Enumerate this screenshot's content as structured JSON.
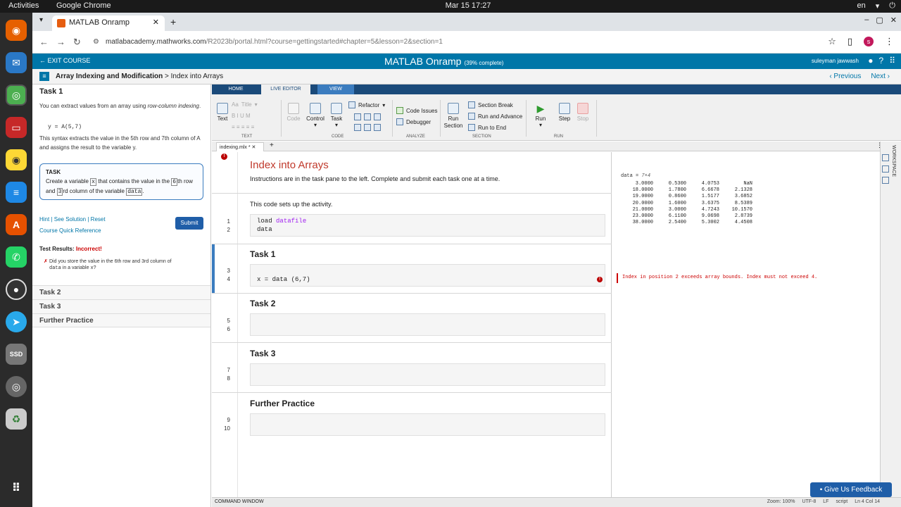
{
  "desktop": {
    "activities": "Activities",
    "app_name": "Google Chrome",
    "clock": "Mar 15  17:27",
    "lang": "en"
  },
  "browser": {
    "tab_title": "MATLAB Onramp",
    "url_host": "matlabacademy.mathworks.com",
    "url_path": "/R2023b/portal.html?course=gettingstarted#chapter=5&lesson=2&section=1",
    "profile_initial": "s"
  },
  "header": {
    "exit": "EXIT COURSE",
    "title": "MATLAB Onramp",
    "progress": "(39% complete)",
    "user": "suleyman jawwash"
  },
  "lessonbar": {
    "lesson": "Array Indexing and Modification",
    "section": "Index into Arrays",
    "previous": "Previous",
    "next": "Next"
  },
  "taskpane": {
    "task1_heading": "Task 1",
    "intro_a": "You can extract values from an array using",
    "intro_em": "row-column indexing",
    "intro_b": ".",
    "code_example": "y = A(5,7)",
    "explain": "This syntax extracts the value in the 5th row and 7th column of A and assigns the result to the variable y.",
    "task_caption": "TASK",
    "task_a": "Create a variable",
    "task_var": "x",
    "task_b": "that contains the value in the",
    "task_row": "6",
    "task_c": "th row and",
    "task_col": "3",
    "task_d": "rd column of the variable",
    "task_data": "data",
    "task_e": ".",
    "hint": "Hint",
    "solution": "See Solution",
    "reset": "Reset",
    "reference": "Course Quick Reference",
    "submit": "Submit",
    "results_label": "Test Results:",
    "results_value": "Incorrect!",
    "result_msg_a": "Did you store the value in the 6th row and 3rd column of",
    "result_msg_b": "data",
    "result_msg_c": "in a variable",
    "result_msg_d": "x",
    "result_msg_e": "?",
    "task2": "Task 2",
    "task3": "Task 3",
    "further": "Further Practice"
  },
  "toolstrip": {
    "tabs": [
      "HOME",
      "LIVE EDITOR",
      "VIEW"
    ],
    "text": "Text",
    "title": "Title",
    "code": "Code",
    "control": "Control",
    "task": "Task",
    "refactor": "Refactor",
    "code_issues": "Code Issues",
    "debugger": "Debugger",
    "run_section": "Run Section",
    "section_break": "Section Break",
    "run_advance": "Run and Advance",
    "run_to_end": "Run to End",
    "run": "Run",
    "step": "Step",
    "stop": "Stop",
    "groups": [
      "TEXT",
      "CODE",
      "ANALYZE",
      "SECTION",
      "RUN"
    ]
  },
  "editor": {
    "tab_name": "indexing.mlx *",
    "title": "Index into Arrays",
    "instructions": "Instructions are in the task pane to the left. Complete and submit each task one at a time.",
    "setup_text": "This code sets up the activity.",
    "code1_kw": "load",
    "code1_arg": "datafile",
    "code2": "data",
    "task1": "Task 1",
    "task1_code": "x = data (6,7)",
    "task2": "Task 2",
    "task3": "Task 3",
    "further": "Further Practice",
    "line_numbers": [
      "1",
      "2",
      "3",
      "4",
      "5",
      "6",
      "7",
      "8",
      "9",
      "10"
    ]
  },
  "output": {
    "var": "data =",
    "dims": "7×4",
    "rows": [
      [
        "3.0000",
        "0.5300",
        "4.0753",
        "NaN"
      ],
      [
        "18.0000",
        "1.7800",
        "6.6678",
        "2.1328"
      ],
      [
        "19.0000",
        "0.8600",
        "1.5177",
        "3.6852"
      ],
      [
        "20.0000",
        "1.6000",
        "3.6375",
        "8.5389"
      ],
      [
        "21.0000",
        "3.0000",
        "4.7243",
        "10.1570"
      ],
      [
        "23.0000",
        "6.1100",
        "9.0698",
        "2.8739"
      ],
      [
        "38.0000",
        "2.5400",
        "5.3002",
        "4.4508"
      ]
    ],
    "error": "Index in position 2 exceeds array bounds. Index must not exceed 4."
  },
  "sidebar": {
    "workspace": "WORKSPACE"
  },
  "statusbar": {
    "command_window": "COMMAND WINDOW",
    "zoom": "Zoom: 100%",
    "encoding": "UTF-8",
    "eol": "LF",
    "mode": "script",
    "position": "Ln 4 Col 14"
  },
  "feedback": "Give Us Feedback"
}
